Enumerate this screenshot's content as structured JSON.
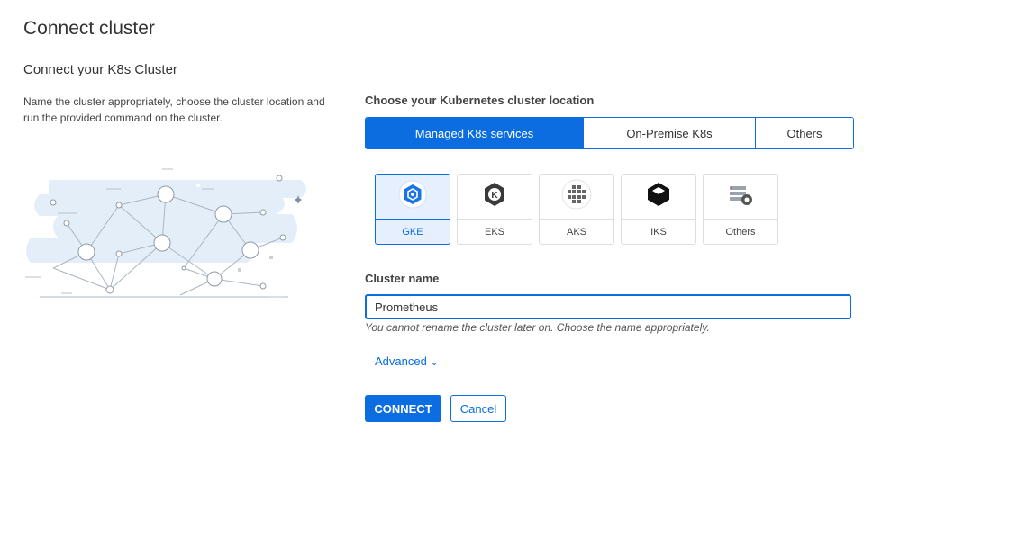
{
  "page": {
    "title": "Connect cluster",
    "subtitle": "Connect your K8s Cluster",
    "description": "Name the cluster appropriately, choose the cluster location and run the provided command on the cluster."
  },
  "location": {
    "label": "Choose your Kubernetes cluster location",
    "tabs": [
      {
        "label": "Managed K8s services",
        "active": true
      },
      {
        "label": "On-Premise K8s",
        "active": false
      },
      {
        "label": "Others",
        "active": false
      }
    ]
  },
  "providers": [
    {
      "label": "GKE",
      "icon": "gke-icon",
      "selected": true
    },
    {
      "label": "EKS",
      "icon": "eks-icon",
      "selected": false
    },
    {
      "label": "AKS",
      "icon": "aks-icon",
      "selected": false
    },
    {
      "label": "IKS",
      "icon": "iks-icon",
      "selected": false
    },
    {
      "label": "Others",
      "icon": "others-server-icon",
      "selected": false
    }
  ],
  "cluster_name": {
    "label": "Cluster name",
    "value": "Prometheus",
    "hint": "You cannot rename the cluster later on. Choose the name appropriately."
  },
  "advanced": {
    "label": "Advanced",
    "chevron": "⌄"
  },
  "actions": {
    "connect_label": "CONNECT",
    "cancel_label": "Cancel"
  },
  "colors": {
    "accent": "#0b6de0",
    "selected_bg": "#e6effd"
  }
}
